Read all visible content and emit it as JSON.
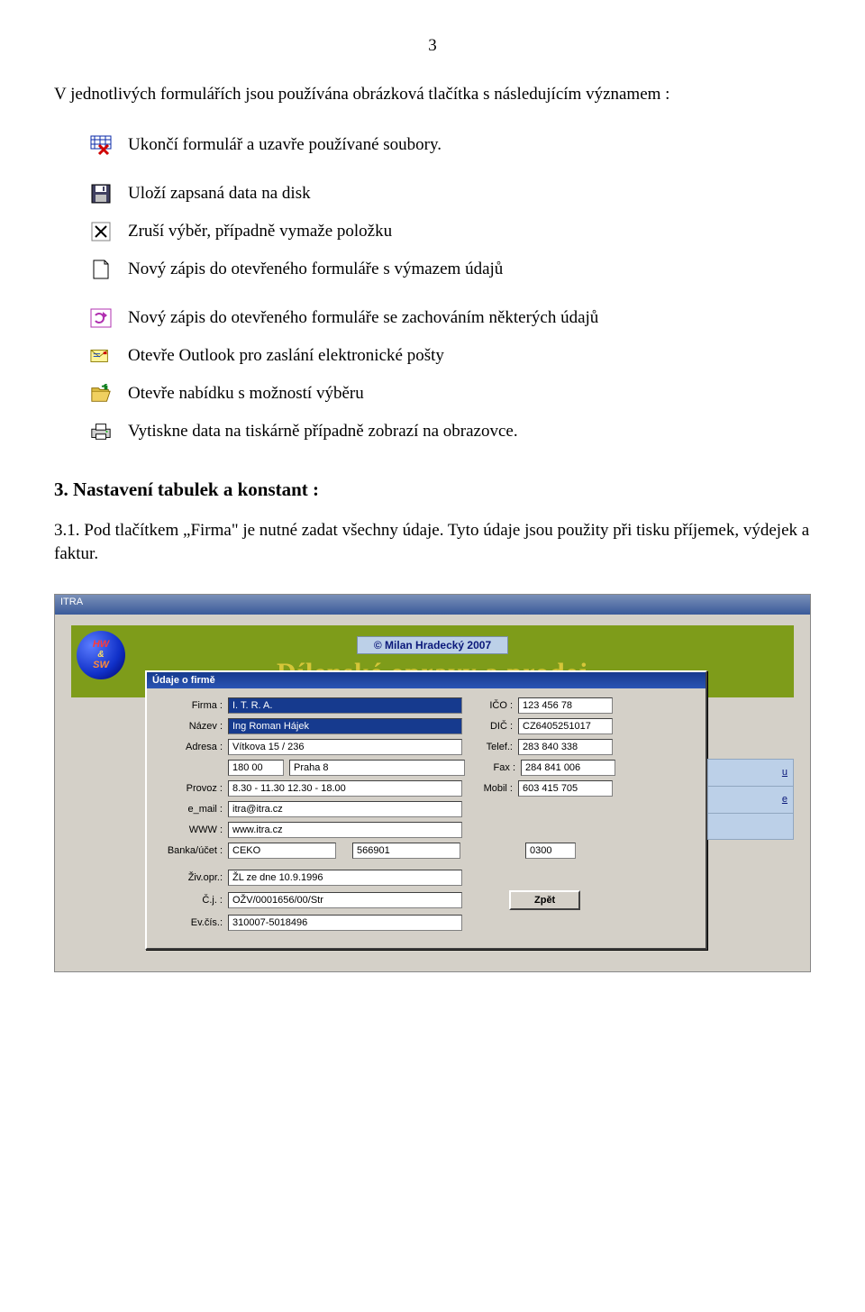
{
  "page_number": "3",
  "intro": "V jednotlivých formulářích jsou používána obrázková tlačítka s následujícím významem :",
  "icons": {
    "close": "Ukončí formulář a uzavře používané soubory.",
    "save": "Uloží zapsaná data na disk",
    "cancel": "Zruší výběr, případně vymaže položku",
    "new": "Nový zápis do otevřeného formuláře s výmazem údajů",
    "copy": "Nový zápis do otevřeného formuláře se zachováním některých údajů",
    "mail": "Otevře Outlook pro zaslání elektronické pošty",
    "open": "Otevře nabídku s možností výběru",
    "print": "Vytiskne data na tiskárně případně zobrazí na obrazovce."
  },
  "section3_heading": "3. Nastavení tabulek a konstant :",
  "section3_1": "3.1. Pod tlačítkem „Firma\" je nutné zadat všechny údaje. Tyto údaje jsou použity při tisku příjemek, výdejek a faktur.",
  "app": {
    "titlebar": "ITRA",
    "banner_copyright": "©   Milan Hradecký  2007",
    "banner_title": "Dílenské opravy a prodej",
    "logo": {
      "hw": "HW",
      "amp": "&",
      "sw": "SW"
    }
  },
  "dialog": {
    "title": "Údaje o firmě",
    "labels": {
      "firma": "Firma :",
      "nazev": "Název :",
      "adresa": "Adresa :",
      "provoz": "Provoz :",
      "email": "e_mail :",
      "www": "WWW :",
      "banka": "Banka/účet :",
      "ziv": "Živ.opr.:",
      "cj": "Č.j. :",
      "evc": "Ev.čís.:",
      "ico": "IČO :",
      "dic": "DIČ :",
      "telef": "Telef.:",
      "fax": "Fax :",
      "mobil": "Mobil :"
    },
    "values": {
      "firma": "I. T. R. A.",
      "nazev": "Ing Roman Hájek",
      "adr_ulice": "Vítkova 15 / 236",
      "adr_psc": "180 00",
      "adr_mesto": "Praha 8",
      "provoz": "8.30 - 11.30     12.30 - 18.00",
      "email": "itra@itra.cz",
      "www": "www.itra.cz",
      "banka": "CEKO",
      "ucet": "566901",
      "kod": "0300",
      "ziv": "ŽL ze dne 10.9.1996",
      "cj": "OŽV/0001656/00/Str",
      "evc": "310007-5018496",
      "ico": "123 456 78",
      "dic": "CZ6405251017",
      "telef": "283 840 338",
      "fax": "284 841 006",
      "mobil": "603 415 705"
    },
    "button_back": "Zpět"
  },
  "peek": {
    "row1": "u",
    "row2": "e",
    "row3": ""
  }
}
